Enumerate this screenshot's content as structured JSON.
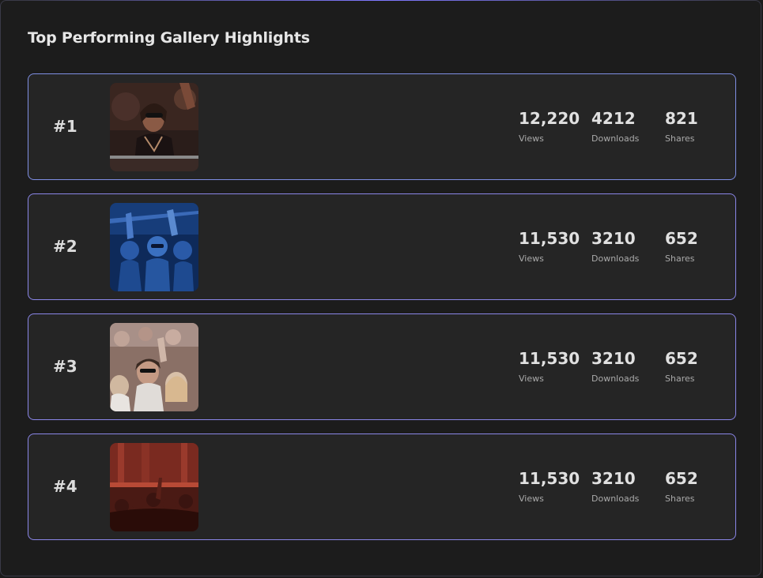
{
  "header": {
    "title": "Top Performing Gallery Highlights"
  },
  "items": [
    {
      "rank": "#1",
      "image": "concert-woman-sunglasses-photo",
      "views": "12,220",
      "downloads": "4212",
      "shares": "821",
      "labels": {
        "views": "Views",
        "downloads": "Downloads",
        "shares": "Shares"
      }
    },
    {
      "rank": "#2",
      "image": "blue-lit-crowd-photo",
      "views": "11,530",
      "downloads": "3210",
      "shares": "652",
      "labels": {
        "views": "Views",
        "downloads": "Downloads",
        "shares": "Shares"
      }
    },
    {
      "rank": "#3",
      "image": "daylight-festival-crowd-photo",
      "views": "11,530",
      "downloads": "3210",
      "shares": "652",
      "labels": {
        "views": "Views",
        "downloads": "Downloads",
        "shares": "Shares"
      }
    },
    {
      "rank": "#4",
      "image": "red-lit-concert-crowd-photo",
      "views": "11,530",
      "downloads": "3210",
      "shares": "652",
      "labels": {
        "views": "Views",
        "downloads": "Downloads",
        "shares": "Shares"
      }
    }
  ],
  "colors": {
    "background": "#1c1c1c",
    "card": "#252525",
    "card_border": "#8a86e8",
    "text": "#e0e0e0",
    "muted": "#a9a9a9"
  }
}
